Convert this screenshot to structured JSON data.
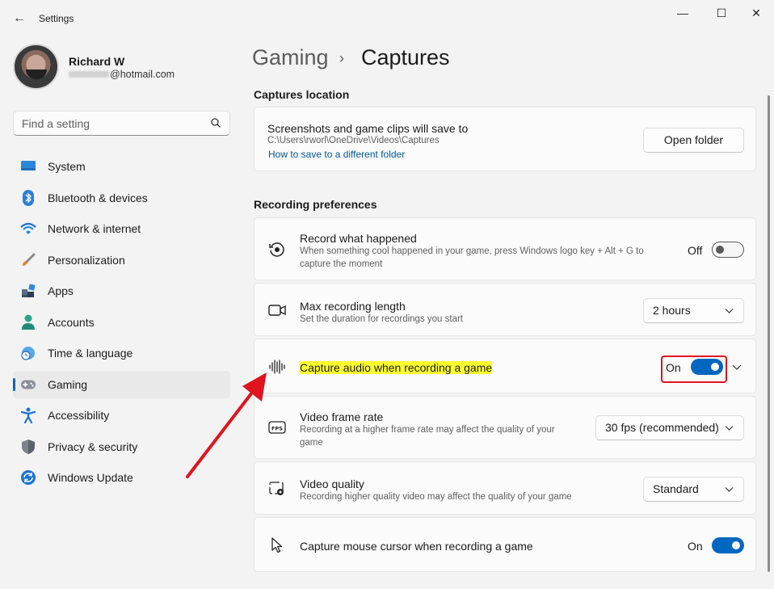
{
  "window": {
    "title": "Settings",
    "back_glyph": "←",
    "minimize_glyph": "—",
    "maximize_glyph": "☐",
    "close_glyph": "✕"
  },
  "user": {
    "name": "Richard W",
    "email": "@hotmail.com"
  },
  "search": {
    "placeholder": "Find a setting"
  },
  "sidebar": {
    "items": [
      {
        "label": "System",
        "icon": "monitor-icon"
      },
      {
        "label": "Bluetooth & devices",
        "icon": "bluetooth-icon"
      },
      {
        "label": "Network & internet",
        "icon": "wifi-icon"
      },
      {
        "label": "Personalization",
        "icon": "brush-icon"
      },
      {
        "label": "Apps",
        "icon": "apps-icon"
      },
      {
        "label": "Accounts",
        "icon": "person-icon"
      },
      {
        "label": "Time & language",
        "icon": "globe-clock-icon"
      },
      {
        "label": "Gaming",
        "icon": "gamepad-icon",
        "active": true
      },
      {
        "label": "Accessibility",
        "icon": "accessibility-icon"
      },
      {
        "label": "Privacy & security",
        "icon": "shield-icon"
      },
      {
        "label": "Windows Update",
        "icon": "update-icon"
      }
    ]
  },
  "breadcrumb": {
    "parent": "Gaming",
    "separator": "›",
    "current": "Captures"
  },
  "captures_location": {
    "section_title": "Captures location",
    "title": "Screenshots and game clips will save to",
    "path": "C:\\Users\\rworl\\OneDrive\\Videos\\Captures",
    "link": "How to save to a different folder",
    "button": "Open folder"
  },
  "recording": {
    "section_title": "Recording preferences",
    "record_what_happened": {
      "title": "Record what happened",
      "desc_line1": "When something cool happened in your game, press Windows logo key + Alt + G to",
      "desc_line2": "capture the moment",
      "state_label": "Off",
      "enabled": false
    },
    "max_length": {
      "title": "Max recording length",
      "desc": "Set the duration for recordings you start",
      "value": "2 hours"
    },
    "capture_audio": {
      "title": "Capture audio when recording a game",
      "state_label": "On",
      "enabled": true,
      "highlight_color": "#ffff2e"
    },
    "frame_rate": {
      "title": "Video frame rate",
      "desc_line1": "Recording at a higher frame rate may affect the quality of your",
      "desc_line2": "game",
      "value": "30 fps (recommended)"
    },
    "video_quality": {
      "title": "Video quality",
      "desc": "Recording higher quality video may affect the quality of your game",
      "value": "Standard"
    },
    "mouse_cursor": {
      "title": "Capture mouse cursor when recording a game",
      "state_label": "On",
      "enabled": true
    }
  },
  "colors": {
    "accent": "#0067c0",
    "annotation": "#e0141e"
  }
}
